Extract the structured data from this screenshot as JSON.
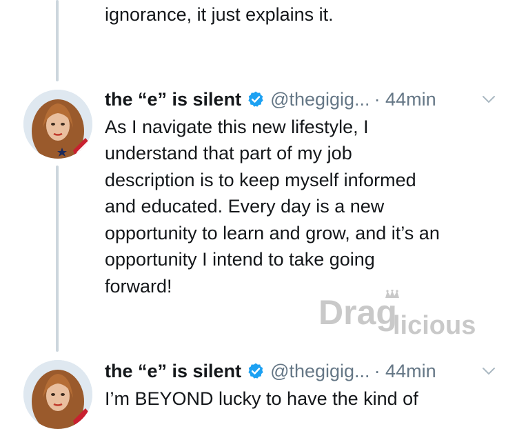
{
  "tweets": [
    {
      "text_lines": [
        "ignorance, it just explains it."
      ]
    },
    {
      "author": "the “e” is silent",
      "handle": "@thegigig...",
      "time": "· 44min",
      "text_lines": [
        "As I navigate this new lifestyle, I",
        "understand that part of my job",
        "description is to keep myself informed",
        "and educated. Every day is a new",
        "opportunity to learn and grow, and it’s an",
        "opportunity I intend to take going",
        "forward!"
      ]
    },
    {
      "author": "the “e” is silent",
      "handle": "@thegigig...",
      "time": "· 44min",
      "text_lines": [
        "I’m BEYOND lucky to have the kind of"
      ]
    }
  ],
  "watermark": {
    "text_part1": "Drag",
    "text_part2": "licious"
  },
  "colors": {
    "verified_blue": "#1da1f2",
    "handle_gray": "#657786",
    "thread_line": "#ccd6dd"
  },
  "icons": [
    "verified-badge-icon",
    "chevron-down-icon",
    "crown-icon"
  ]
}
